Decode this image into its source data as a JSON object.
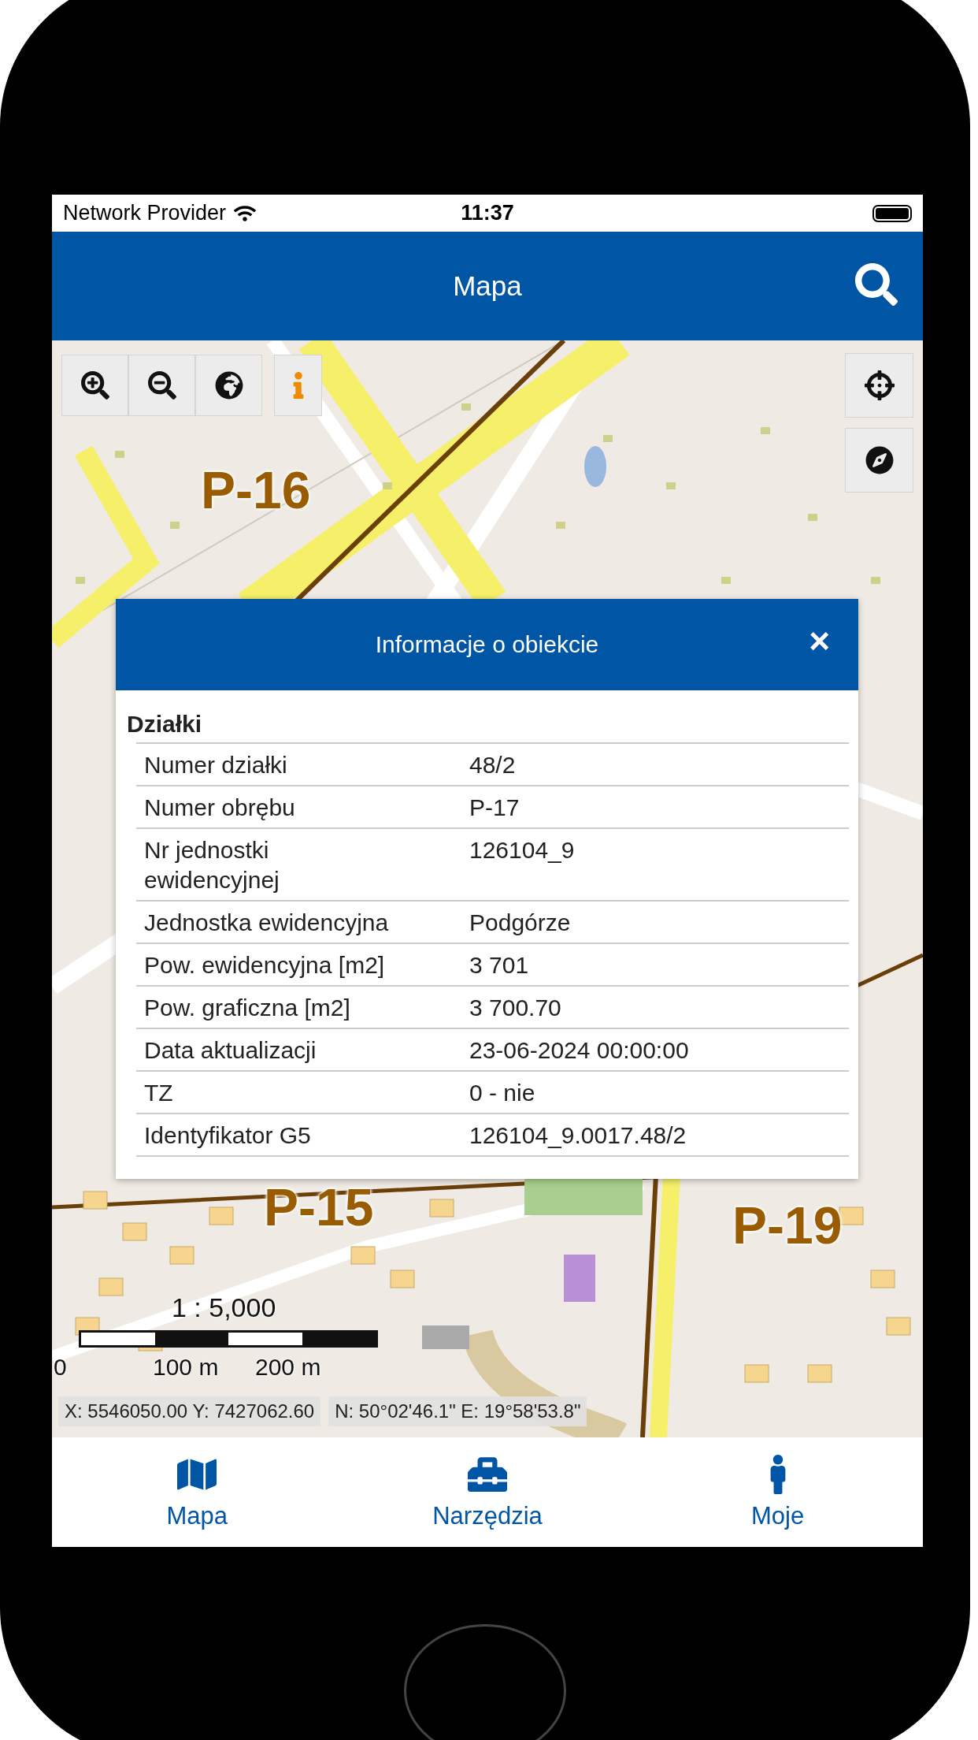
{
  "status_bar": {
    "carrier": "Network Provider",
    "time": "11:37"
  },
  "header": {
    "title": "Mapa"
  },
  "map": {
    "labels": [
      "P-16",
      "P-15",
      "P-19"
    ],
    "scale": "1 : 5,000",
    "scale_labels": [
      "0",
      "100 m",
      "200 m"
    ],
    "coordinates": [
      "X: 5546050.00 Y: 7427062.60",
      "N: 50°02'46.1\" E: 19°58'53.8\""
    ]
  },
  "dialog": {
    "title": "Informacje o obiekcie",
    "close": "×",
    "section": "Działki",
    "rows": [
      {
        "label": "Numer działki",
        "value": "48/2"
      },
      {
        "label": "Numer obrębu",
        "value": "P-17"
      },
      {
        "label": "Nr jednostki ewidencyjnej",
        "value": "126104_9"
      },
      {
        "label": "Jednostka ewidencyjna",
        "value": "Podgórze"
      },
      {
        "label": "Pow. ewidencyjna [m2]",
        "value": "3 701"
      },
      {
        "label": "Pow. graficzna [m2]",
        "value": "3 700.70"
      },
      {
        "label": "Data aktualizacji",
        "value": "23-06-2024 00:00:00"
      },
      {
        "label": "TZ",
        "value": "0 - nie"
      },
      {
        "label": "Identyfikator G5",
        "value": "126104_9.0017.48/2"
      }
    ]
  },
  "tab_bar": [
    {
      "label": "Mapa"
    },
    {
      "label": "Narzędzia"
    },
    {
      "label": "Moje"
    }
  ]
}
